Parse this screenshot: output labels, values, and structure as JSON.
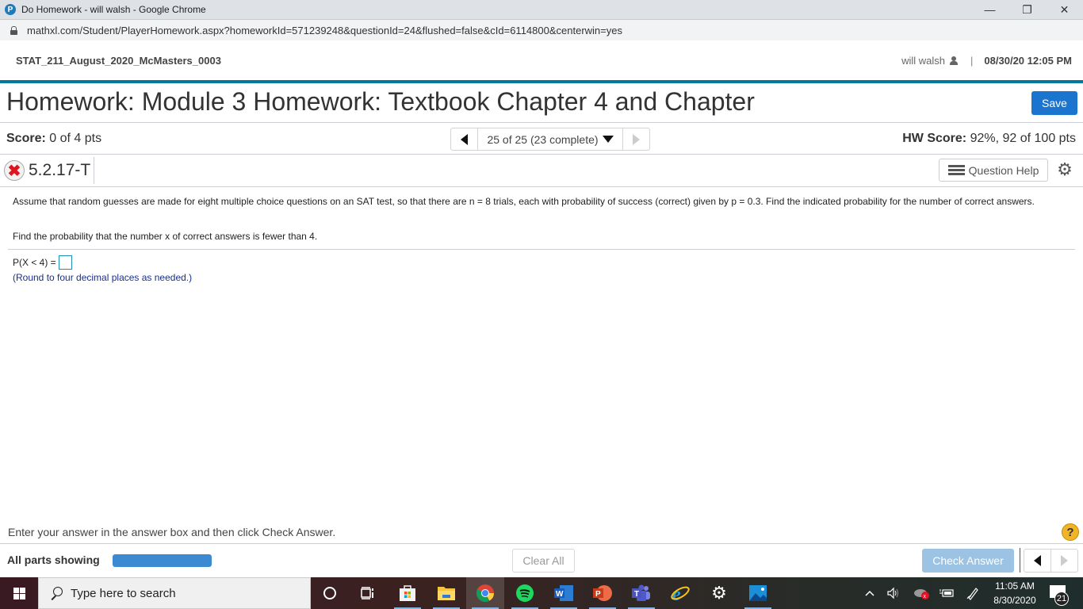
{
  "browser": {
    "window_title": "Do Homework - will walsh - Google Chrome",
    "favicon_letter": "P",
    "url": "mathxl.com/Student/PlayerHomework.aspx?homeworkId=571239248&questionId=24&flushed=false&cId=6114800&centerwin=yes",
    "controls": {
      "minimize": "—",
      "restore": "❐",
      "close": "✕"
    }
  },
  "header": {
    "course_name": "STAT_211_August_2020_McMasters_0003",
    "user_name": "will walsh",
    "separator": "|",
    "datetime": "08/30/20 12:05 PM"
  },
  "homework": {
    "title": "Homework: Module 3 Homework: Textbook Chapter 4 and Chapter",
    "save_label": "Save"
  },
  "score_row": {
    "score_label": "Score:",
    "score_value": " 0 of 4 pts",
    "question_nav": "25 of 25 (23 complete)",
    "hw_score_label": "HW Score:",
    "hw_score_value": " 92%, 92 of 100 pts"
  },
  "question": {
    "status_icon": "incorrect-x",
    "status_glyph": "✖",
    "id": "5.2.17-T",
    "help_label": "Question Help",
    "gear_glyph": "⚙",
    "text": "Assume that random guesses are made for eight multiple choice questions on an SAT test, so that there are n = 8 trials, each with probability of success (correct) given by p = 0.3. Find the indicated probability for the number of correct answers.",
    "prompt": "Find the probability that the number x of correct answers is fewer than 4.",
    "answer_label": "P(X < 4) =",
    "answer_value": "",
    "hint": "(Round to four decimal places as needed.)"
  },
  "footer": {
    "instruction": "Enter your answer in the answer box and then click Check Answer.",
    "help_glyph": "?",
    "parts_label": "All parts showing",
    "parts_progress_percent": 100,
    "clear_label": "Clear All",
    "check_label": "Check Answer"
  },
  "taskbar": {
    "search_placeholder": "Type here to search",
    "apps": [
      "cortana",
      "task-view",
      "microsoft-store",
      "file-explorer",
      "chrome",
      "spotify",
      "word",
      "powerpoint",
      "teams",
      "internet-explorer",
      "settings",
      "photos"
    ],
    "time": "11:05 AM",
    "date": "8/30/2020",
    "notification_count": "21"
  }
}
